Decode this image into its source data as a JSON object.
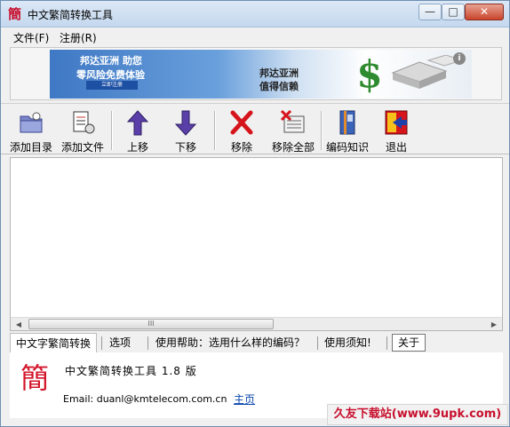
{
  "window": {
    "title": "中文繁简转换工具",
    "app_icon_char": "簡",
    "min_glyph": "—",
    "max_glyph": "□",
    "close_glyph": "✕"
  },
  "menu": [
    {
      "label": "文件(F)"
    },
    {
      "label": "注册(R)"
    }
  ],
  "banner": {
    "left_line1": "邦达亚洲  助您",
    "left_line2": "零风险免费体验",
    "button": "立即注册",
    "right_line1": "邦达亚洲",
    "right_line2": "值得信赖",
    "dollar": "$",
    "info": "i"
  },
  "toolbar": [
    {
      "id": "add-dir",
      "label": "添加目录",
      "icon": "folder-add-icon"
    },
    {
      "id": "add-file",
      "label": "添加文件",
      "icon": "file-add-icon"
    },
    {
      "id": "move-up",
      "label": "上移",
      "icon": "arrow-up-icon"
    },
    {
      "id": "move-down",
      "label": "下移",
      "icon": "arrow-down-icon"
    },
    {
      "id": "remove",
      "label": "移除",
      "icon": "x-icon"
    },
    {
      "id": "remove-all",
      "label": "移除全部",
      "icon": "remove-all-icon"
    },
    {
      "id": "encoding-info",
      "label": "编码知识",
      "icon": "book-icon"
    },
    {
      "id": "exit",
      "label": "退出",
      "icon": "exit-icon"
    }
  ],
  "list": {
    "scroll_thumb_grip": "III"
  },
  "tabs": [
    {
      "label": "中文字繁简转换",
      "active": true
    },
    {
      "label": "选项"
    },
    {
      "label": "使用帮助：选用什么样的编码？"
    },
    {
      "label": "使用须知!"
    },
    {
      "label": "关于"
    }
  ],
  "about": {
    "logo_char": "簡",
    "product": "中文繁简转换工具 1.8 版",
    "email": "Email: duanl@kmtelecom.com.cn",
    "homepage": "主页"
  },
  "watermark": "久友下载站(www.9upk.com)",
  "colors": {
    "accent_red": "#c8102e",
    "banner_blue": "#3f78c4",
    "arrow_purple": "#5b3fa8"
  }
}
